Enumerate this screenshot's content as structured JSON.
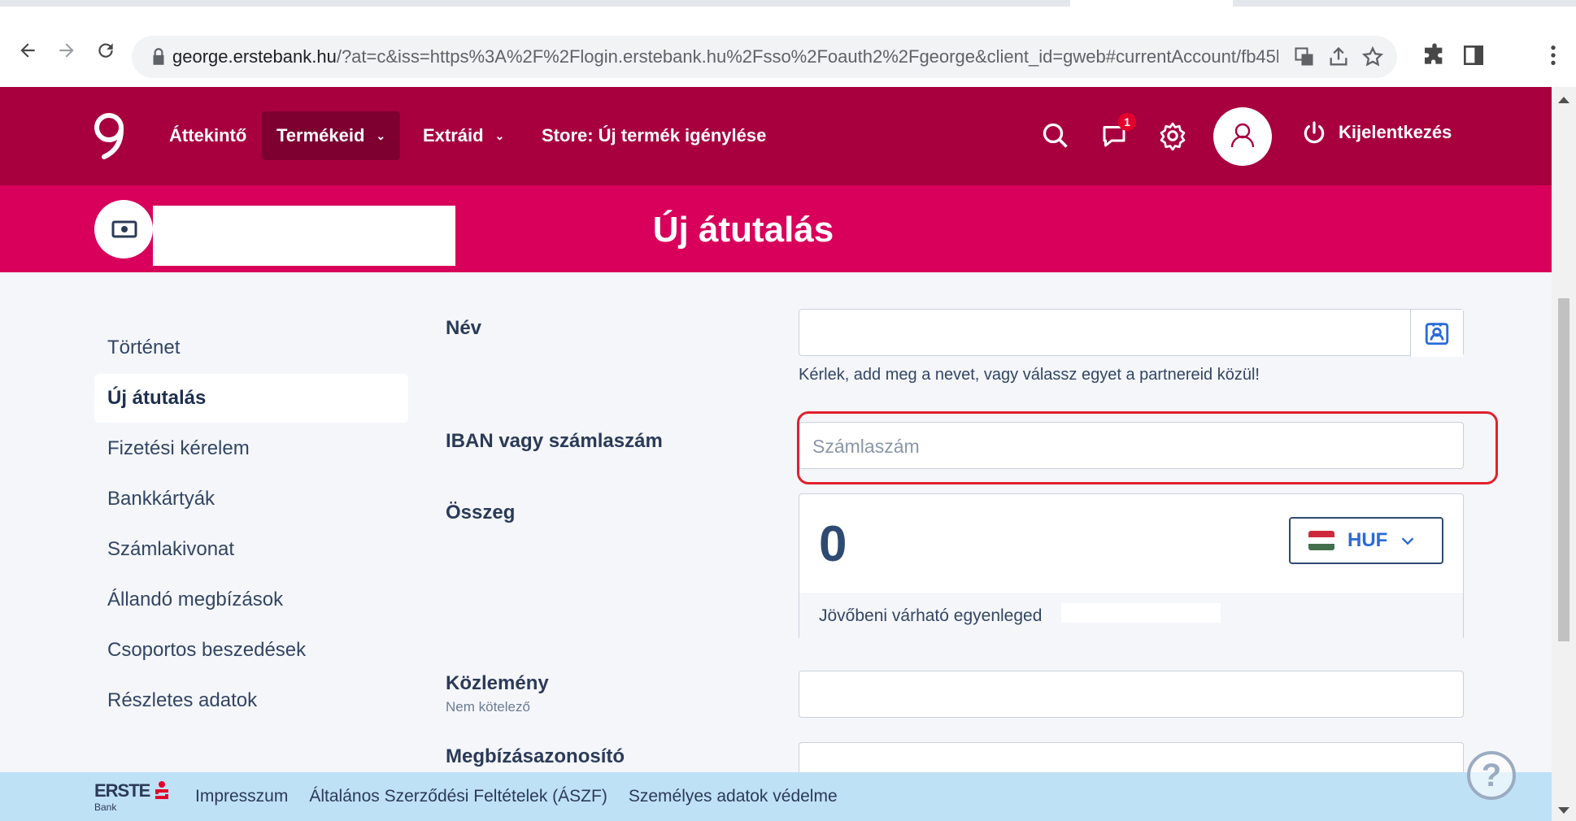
{
  "browser": {
    "url_host": "george.erstebank.hu",
    "url_rest": "/?at=c&iss=https%3A%2F%2Flogin.erstebank.hu%2Fsso%2Foauth2%2Fgeorge&client_id=gweb#currentAccount/fb45b25d..."
  },
  "header": {
    "nav": [
      {
        "label": "Áttekintő"
      },
      {
        "label": "Termékeid"
      },
      {
        "label": "Extráid"
      },
      {
        "label": "Store: Új termék igénylése"
      }
    ],
    "messages_badge": "1",
    "logout_label": "Kijelentkezés"
  },
  "title": "Új átutalás",
  "sidebar": {
    "items": [
      {
        "label": "Történet"
      },
      {
        "label": "Új átutalás"
      },
      {
        "label": "Fizetési kérelem"
      },
      {
        "label": "Bankkártyák"
      },
      {
        "label": "Számlakivonat"
      },
      {
        "label": "Állandó megbízások"
      },
      {
        "label": "Csoportos beszedések"
      },
      {
        "label": "Részletes adatok"
      }
    ]
  },
  "form": {
    "name_label": "Név",
    "name_hint": "Kérlek, add meg a nevet, vagy válassz egyet a partnereid közül!",
    "iban_label": "IBAN vagy számlaszám",
    "iban_placeholder": "Számlaszám",
    "amount_label": "Összeg",
    "amount_value": "0",
    "currency": "HUF",
    "balance_label": "Jövőbeni várható egyenleged",
    "note_label": "Közlemény",
    "note_sub": "Nem kötelező",
    "order_id_label": "Megbízásazonosító"
  },
  "footer": {
    "brand": "ERSTE",
    "brand_sub": "Bank",
    "links": [
      {
        "label": "Impresszum"
      },
      {
        "label": "Általános Szerződési Feltételek (ÁSZF)"
      },
      {
        "label": "Személyes adatok védelme"
      }
    ]
  },
  "colors": {
    "appbar": "#a8003f",
    "titleband": "#d8005a",
    "highlight": "#e0202e"
  }
}
